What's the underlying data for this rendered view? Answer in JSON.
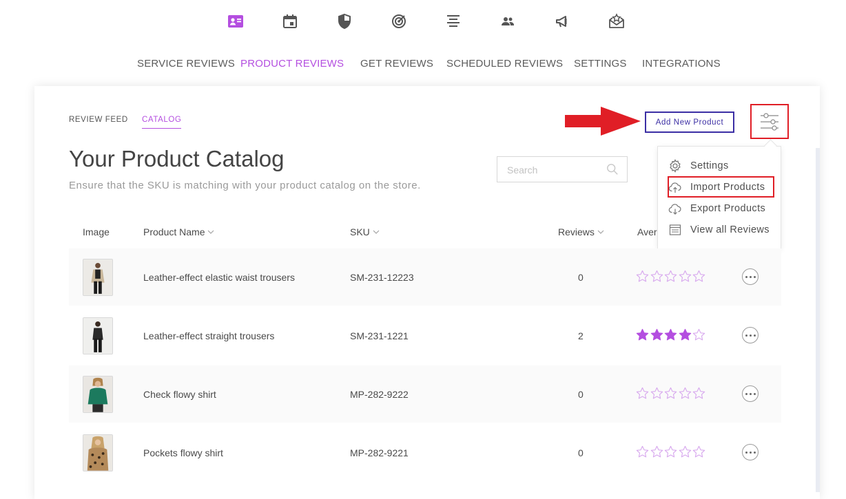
{
  "top_icons": [
    {
      "name": "contact-card-icon",
      "active": true
    },
    {
      "name": "calendar-icon",
      "active": false
    },
    {
      "name": "shield-icon",
      "active": false
    },
    {
      "name": "target-icon",
      "active": false
    },
    {
      "name": "align-center-icon",
      "active": false
    },
    {
      "name": "people-icon",
      "active": false
    },
    {
      "name": "megaphone-icon",
      "active": false
    },
    {
      "name": "envelope-star-icon",
      "active": false
    }
  ],
  "nav": {
    "service_reviews": "SERVICE REVIEWS",
    "product_reviews": "PRODUCT REVIEWS",
    "get_reviews": "GET REVIEWS",
    "scheduled_reviews": "SCHEDULED REVIEWS",
    "settings": "SETTINGS",
    "integrations": "INTEGRATIONS",
    "active": "PRODUCT REVIEWS"
  },
  "subtabs": {
    "review_feed": "REVIEW FEED",
    "catalog": "CATALOG",
    "active": "CATALOG"
  },
  "page": {
    "title": "Your Product Catalog",
    "subtitle": "Ensure that the SKU is matching with your product catalog on the store."
  },
  "search": {
    "placeholder": "Search",
    "value": ""
  },
  "toolbar": {
    "add_new_product": "Add New Product"
  },
  "menu": {
    "settings": "Settings",
    "import_products": "Import Products",
    "export_products": "Export Products",
    "view_all_reviews": "View all Reviews"
  },
  "table": {
    "headers": {
      "image": "Image",
      "product_name": "Product Name",
      "sku": "SKU",
      "reviews": "Reviews",
      "average": "Aver"
    },
    "rows": [
      {
        "name": "Leather-effect elastic waist trousers",
        "sku": "SM-231-12223",
        "reviews": "0",
        "rating": 0
      },
      {
        "name": "Leather-effect straight trousers",
        "sku": "SM-231-1221",
        "reviews": "2",
        "rating": 4
      },
      {
        "name": "Check flowy shirt",
        "sku": "MP-282-9222",
        "reviews": "0",
        "rating": 0
      },
      {
        "name": "Pockets flowy shirt",
        "sku": "MP-282-9221",
        "reviews": "0",
        "rating": 0
      }
    ]
  },
  "colors": {
    "accent": "#b44ee0",
    "button_border": "#3b2ea4",
    "highlight_red": "#e01e26",
    "star_filled": "#b44ee0",
    "star_empty": "#d8a9ee"
  }
}
